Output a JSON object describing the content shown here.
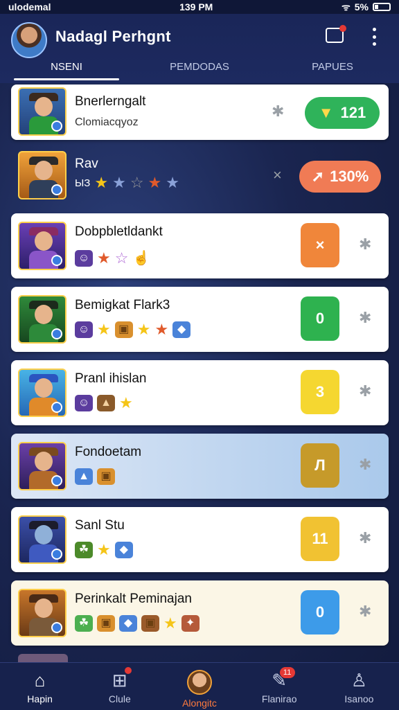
{
  "status": {
    "carrier": "ulodemal",
    "time": "139 PM",
    "battery": "5%"
  },
  "header": {
    "title": "Nadagl Perhgnt"
  },
  "tabs": [
    {
      "label": "NSENI",
      "active": true
    },
    {
      "label": "PEMDODAS",
      "active": false
    },
    {
      "label": "PAPUES",
      "active": false
    }
  ],
  "list": [
    {
      "name": "Bnerlerngalt",
      "subtitle": "Clomiacqyoz",
      "action": "121",
      "action_color": "#2fb35a",
      "style": "white"
    },
    {
      "name": "Rav",
      "subtitle": "ЫЗ",
      "action": "130%",
      "action_color": "#f07b55",
      "style": "plain"
    },
    {
      "name": "Dobpbletldankt",
      "action": "×",
      "action_color": "#f0863a",
      "style": "white"
    },
    {
      "name": "Bemigkat Flark3",
      "action": "0",
      "action_color": "#2eb24f",
      "style": "white"
    },
    {
      "name": "Pranl ihislan",
      "action": "3",
      "action_color": "#f5d730",
      "style": "white"
    },
    {
      "name": "Fondoetam",
      "action": "Л",
      "action_color": "#c69a2a",
      "style": "blue"
    },
    {
      "name": "Sanl Stu",
      "action": "11",
      "action_color": "#f1c232",
      "style": "white"
    },
    {
      "name": "Perinkalt Peminajan",
      "action": "0",
      "action_color": "#3d9be9",
      "style": "cream"
    }
  ],
  "bottom_nav": [
    {
      "label": "Hapin",
      "icon": "home-icon",
      "active": true
    },
    {
      "label": "Clule",
      "icon": "gift-icon",
      "badge": ""
    },
    {
      "label": "Alongitc",
      "icon": "avatar-icon",
      "highlight": true
    },
    {
      "label": "Flanirao",
      "icon": "chat-icon",
      "badge": "11"
    },
    {
      "label": "Isanoo",
      "icon": "user-icon"
    }
  ]
}
